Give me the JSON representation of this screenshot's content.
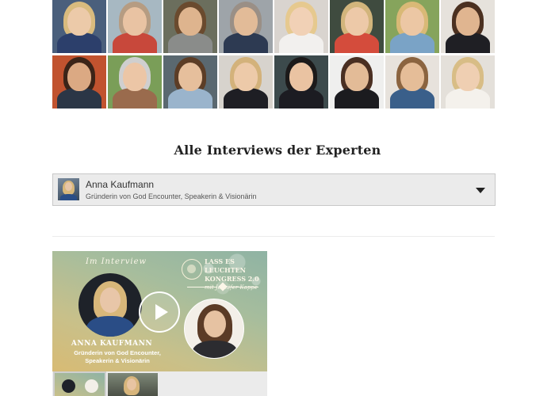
{
  "experts": [
    {
      "name": "expert-1",
      "bg": "#4a5f7c",
      "hair": "#d9bb7e",
      "skin": "#eccaa9",
      "top": "#2c3f6b"
    },
    {
      "name": "expert-2",
      "bg": "#a7b8c2",
      "hair": "#b69c82",
      "skin": "#e9c3a3",
      "top": "#c8483b"
    },
    {
      "name": "expert-3",
      "bg": "#6b6e5d",
      "hair": "#6a4a2e",
      "skin": "#deb48e",
      "top": "#8a8c8a"
    },
    {
      "name": "expert-4",
      "bg": "#9ea4a9",
      "hair": "#9a8f86",
      "skin": "#e2bb98",
      "top": "#2d3a52"
    },
    {
      "name": "expert-5",
      "bg": "#d9d4cf",
      "hair": "#e6c98f",
      "skin": "#f1d1b6",
      "top": "#f2f0ee"
    },
    {
      "name": "expert-6",
      "bg": "#3f4b3f",
      "hair": "#d2b57c",
      "skin": "#edc9a8",
      "top": "#d44c3c"
    },
    {
      "name": "expert-7",
      "bg": "#86a45c",
      "hair": "#d9b976",
      "skin": "#ecc7a4",
      "top": "#7aa3c6"
    },
    {
      "name": "expert-8",
      "bg": "#e6e2dc",
      "hair": "#4b3020",
      "skin": "#e0b590",
      "top": "#1f1f24"
    },
    {
      "name": "expert-9",
      "bg": "#c1532f",
      "hair": "#3b2418",
      "skin": "#dba983",
      "top": "#2b3646"
    },
    {
      "name": "expert-10",
      "bg": "#7a9e58",
      "hair": "#cfcfcf",
      "skin": "#ecc6a6",
      "top": "#9a6b4d"
    },
    {
      "name": "expert-11",
      "bg": "#5a6870",
      "hair": "#5c3d26",
      "skin": "#e6bf9c",
      "top": "#9ab4cc"
    },
    {
      "name": "expert-12",
      "bg": "#d7d3cd",
      "hair": "#d3b27b",
      "skin": "#edcaa9",
      "top": "#1e1e24"
    },
    {
      "name": "expert-13",
      "bg": "#3c4a4c",
      "hair": "#1c1a1a",
      "skin": "#eac3a2",
      "top": "#1c1c22"
    },
    {
      "name": "expert-14",
      "bg": "#efefee",
      "hair": "#4a2f22",
      "skin": "#e3bb97",
      "top": "#1b1b1f"
    },
    {
      "name": "expert-15",
      "bg": "#e7e2dc",
      "hair": "#8b6440",
      "skin": "#e5bd98",
      "top": "#3a5f8a"
    },
    {
      "name": "expert-16",
      "bg": "#e4e0da",
      "hair": "#d8bd86",
      "skin": "#efcfb2",
      "top": "#f4f1ec"
    }
  ],
  "section": {
    "title": "Alle Interviews der Experten"
  },
  "selector": {
    "name": "Anna Kaufmann",
    "role": "Gründerin von God Encounter, Speakerin & Visionärin"
  },
  "video": {
    "label": "Im Interview",
    "event_title_line1": "LASS ES",
    "event_title_line2": "LEUCHTEN",
    "event_title_line3": "KONGRESS 2.0",
    "event_host": "mit Jennifer Kappe",
    "guest_name": "ANNA KAUFMANN",
    "guest_role_line1": "Gründerin von God Encounter,",
    "guest_role_line2": "Speakerin & Visionärin"
  }
}
